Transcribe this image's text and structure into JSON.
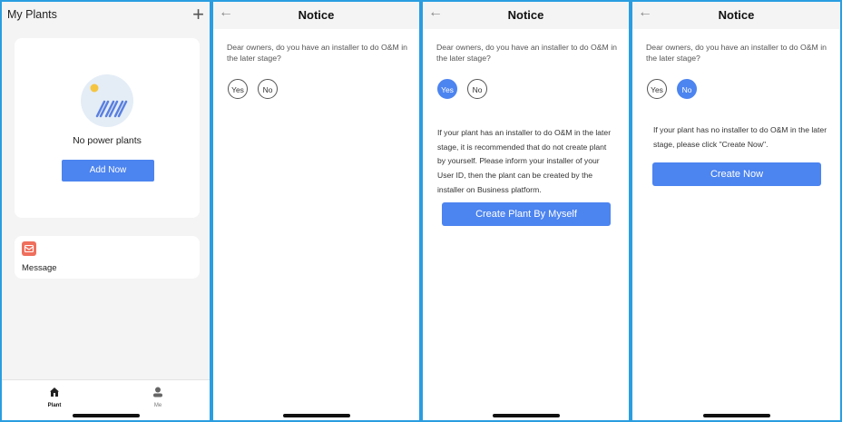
{
  "screen1": {
    "title": "My Plants",
    "add_icon": "plus-icon",
    "empty_text": "No power plants",
    "add_button": "Add Now",
    "message_label": "Message",
    "tabs": [
      {
        "label": "Plant",
        "icon": "home-icon"
      },
      {
        "label": "Me",
        "icon": "user-icon"
      }
    ]
  },
  "notice": {
    "title": "Notice",
    "question": "Dear owners, do you have an installer to do O&M in the later stage?",
    "yes": "Yes",
    "no": "No"
  },
  "screen3": {
    "selected": "Yes",
    "info": "If your plant has an installer to do O&M in the later stage, it is recommended that do not create plant by yourself. Please inform your installer of your User ID, then the plant can be created by the installer on Business platform.",
    "button": "Create Plant By Myself"
  },
  "screen4": {
    "selected": "No",
    "info": "If your plant has no installer to do O&M in the later stage, please click \"Create Now\".",
    "button": "Create Now"
  },
  "colors": {
    "accent": "#4c84f0",
    "message_icon": "#ef6f5c",
    "frame": "#2a9ee0"
  }
}
